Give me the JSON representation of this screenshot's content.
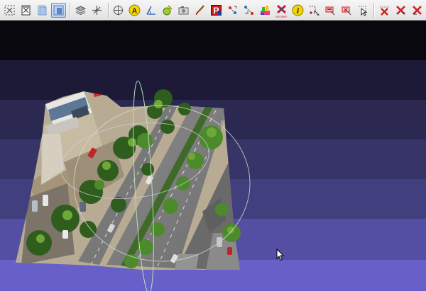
{
  "app": {
    "window_kind": "3D point cloud viewer",
    "toolbar": {
      "buttons": [
        {
          "id": "view-fit",
          "icon": "fit-view-icon",
          "active": false
        },
        {
          "id": "view-iso",
          "icon": "iso-view-icon",
          "active": false
        },
        {
          "id": "view-ortho",
          "icon": "ortho-view-icon",
          "active": false
        },
        {
          "id": "view-persp",
          "icon": "perspective-view-icon",
          "active": true
        },
        {
          "id": "layers",
          "icon": "layers-icon",
          "active": false
        },
        {
          "id": "axes",
          "icon": "axes-icon",
          "active": false
        },
        {
          "id": "target",
          "icon": "target-icon",
          "active": false
        },
        {
          "id": "annotate",
          "icon": "annotation-icon",
          "label": "A",
          "active": false
        },
        {
          "id": "measure",
          "icon": "measure-angle-icon",
          "active": false
        },
        {
          "id": "pick",
          "icon": "pick-point-icon",
          "active": false
        },
        {
          "id": "camera",
          "icon": "camera-icon",
          "active": false
        },
        {
          "id": "brush",
          "icon": "brush-icon",
          "active": false
        },
        {
          "id": "color-pick",
          "icon": "color-picker-icon",
          "active": false
        },
        {
          "id": "transform",
          "icon": "transform-icon",
          "active": false
        },
        {
          "id": "transform2",
          "icon": "transform-alt-icon",
          "active": false
        },
        {
          "id": "palette",
          "icon": "palette-icon",
          "active": false
        },
        {
          "id": "georef",
          "icon": "georef-icon",
          "label": "GEOREF",
          "active": false
        },
        {
          "id": "info",
          "icon": "info-icon",
          "label": "i",
          "active": false
        },
        {
          "id": "select-add",
          "icon": "select-add-icon",
          "active": false
        },
        {
          "id": "select-sub",
          "icon": "select-subtract-icon",
          "active": false
        },
        {
          "id": "select-inter",
          "icon": "select-intersect-icon",
          "active": false
        },
        {
          "id": "select-pointer",
          "icon": "select-pointer-icon",
          "active": false
        },
        {
          "id": "delete-1",
          "icon": "delete-x-icon",
          "active": false
        },
        {
          "id": "delete-2",
          "icon": "delete-x-alt-icon",
          "active": false
        },
        {
          "id": "delete-3",
          "icon": "delete-x-red-icon",
          "active": false
        }
      ]
    },
    "colors": {
      "bg_top": "#08080f",
      "bg_bottom": "#6a66cc",
      "accent_red": "#d21d1d",
      "accent_yellow": "#f2d200",
      "gizmo": "#c8e0c8"
    }
  }
}
